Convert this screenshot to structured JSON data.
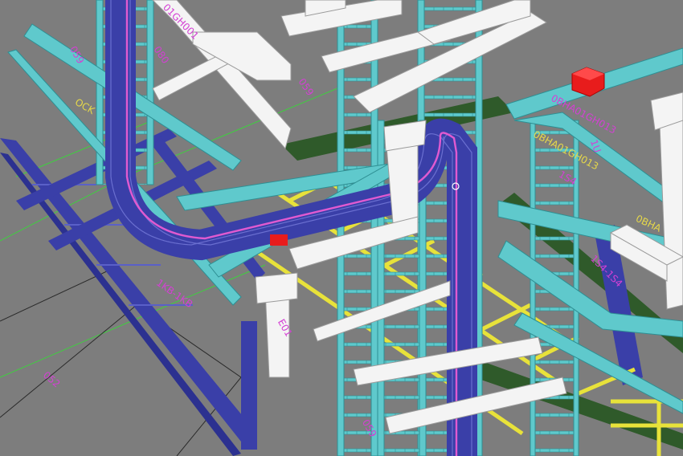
{
  "viewport": {
    "background": "#7d7d7d",
    "colors": {
      "tray_cyan": "#5fc9cc",
      "tray_edge": "#2e8f93",
      "tray_blue": "#3a3fa8",
      "cable_pink": "#e05ad0",
      "tray_yellow": "#e8e23a",
      "beam_white": "#f4f4f4",
      "steel_green": "#2f5a2a",
      "guide_green": "#3fcf3f",
      "marker_red": "#e81c1c",
      "label_magenta": "#d440d4",
      "label_yellow": "#e6d84a"
    }
  },
  "annotations": [
    {
      "id": "ann-01gh001",
      "text": "01GH001",
      "color": "magenta"
    },
    {
      "id": "ann-059-a",
      "text": "059",
      "color": "magenta"
    },
    {
      "id": "ann-080",
      "text": "080",
      "color": "magenta"
    },
    {
      "id": "ann-ock",
      "text": "OCK",
      "color": "yellow"
    },
    {
      "id": "ann-059-b",
      "text": "059",
      "color": "magenta"
    },
    {
      "id": "ann-0bha01gh013",
      "text": "0BHA01GH013",
      "color": "magenta"
    },
    {
      "id": "ann-0bha01gh013-b",
      "text": "0BHA01GH013",
      "color": "yellow"
    },
    {
      "id": "ann-1u",
      "text": "1U",
      "color": "magenta"
    },
    {
      "id": "ann-1s4",
      "text": "1S4",
      "color": "magenta"
    },
    {
      "id": "ann-0bha",
      "text": "0BHA",
      "color": "yellow"
    },
    {
      "id": "ann-1s4-2",
      "text": "1S4-1S4",
      "color": "magenta"
    },
    {
      "id": "ann-1kb",
      "text": "1KB-1KB",
      "color": "magenta"
    },
    {
      "id": "ann-e01",
      "text": "E01",
      "color": "magenta"
    },
    {
      "id": "ann-052",
      "text": "052",
      "color": "magenta"
    },
    {
      "id": "ann-059-c",
      "text": "059",
      "color": "magenta"
    }
  ]
}
